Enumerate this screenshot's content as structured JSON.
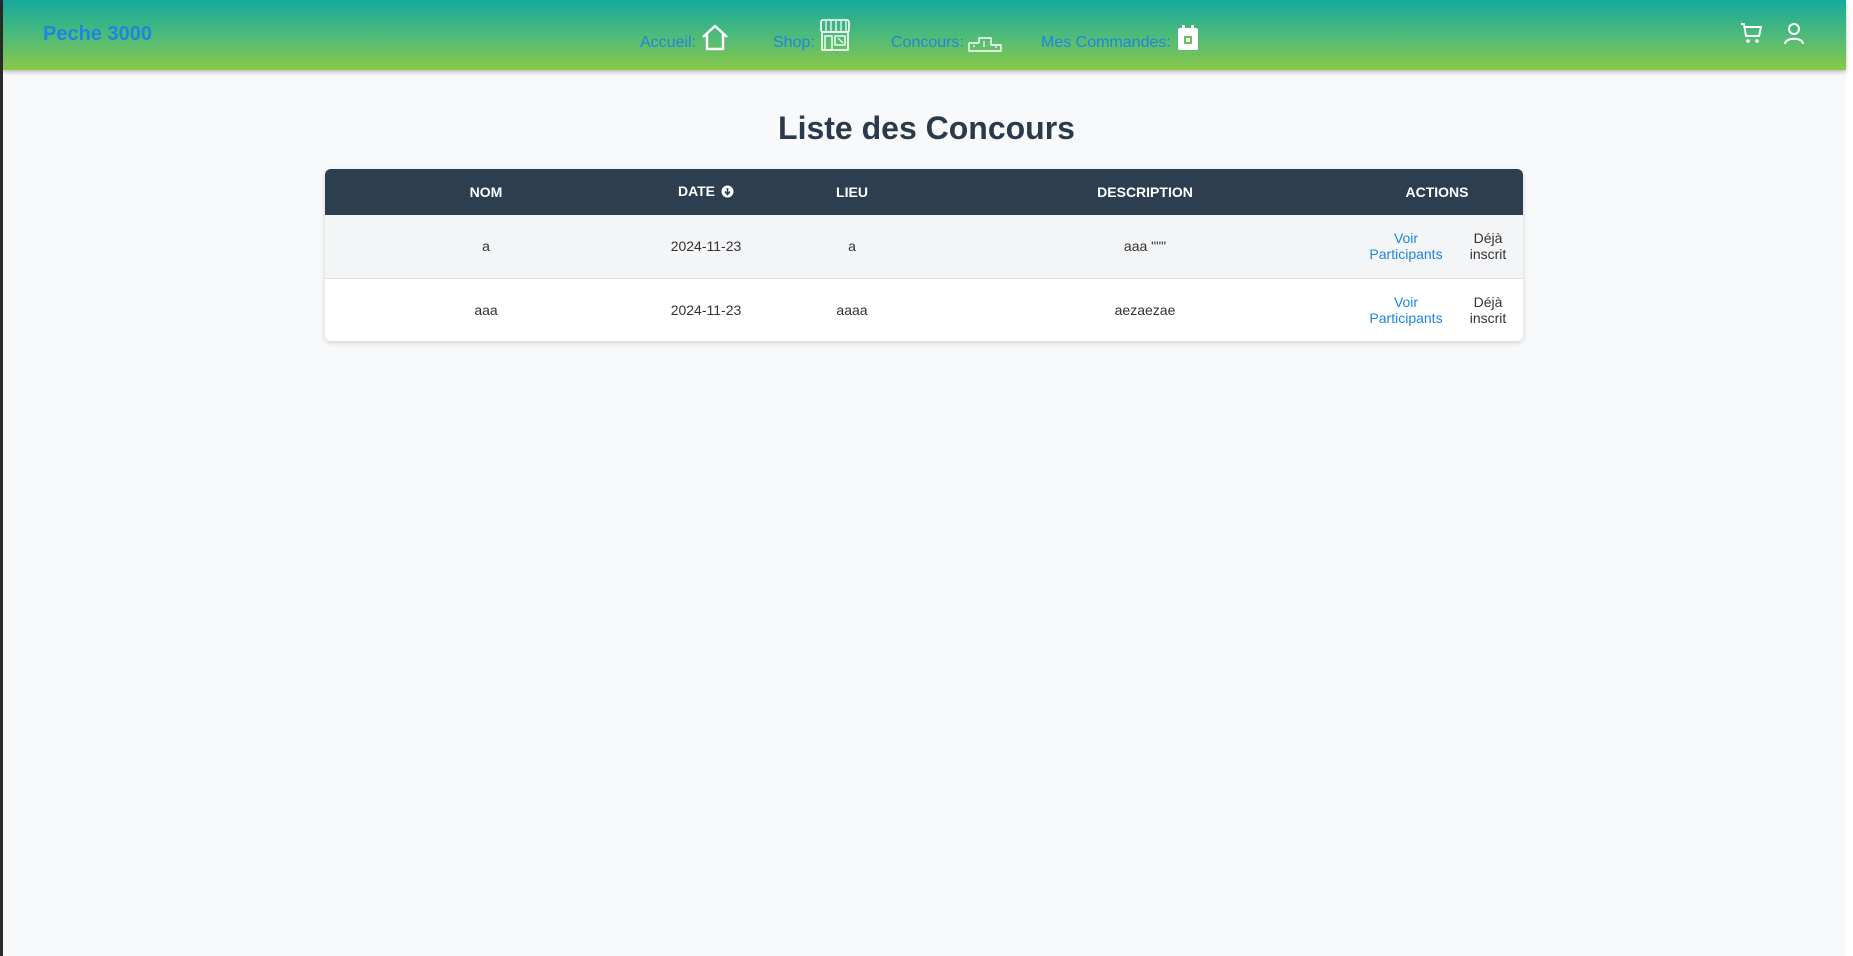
{
  "header": {
    "brand": "Peche 3000",
    "nav": [
      {
        "label": "Accueil:",
        "icon": "home-icon"
      },
      {
        "label": "Shop:",
        "icon": "shop-icon"
      },
      {
        "label": "Concours:",
        "icon": "podium-icon"
      },
      {
        "label": "Mes Commandes:",
        "icon": "calendar-icon"
      }
    ],
    "right_icons": [
      "cart-icon",
      "user-icon"
    ]
  },
  "page": {
    "title": "Liste des Concours"
  },
  "table": {
    "columns": [
      "NOM",
      "DATE",
      "LIEU",
      "DESCRIPTION",
      "ACTIONS"
    ],
    "sort_icon": "sort-desc-icon",
    "rows": [
      {
        "nom": "a",
        "date": "2024-11-23",
        "lieu": "a",
        "description": "aaa \"\"\"",
        "voir": "Voir Participants",
        "statut": "Déjà inscrit"
      },
      {
        "nom": "aaa",
        "date": "2024-11-23",
        "lieu": "aaaa",
        "description": "aezaezae",
        "voir": "Voir Participants",
        "statut": "Déjà inscrit"
      }
    ]
  },
  "colors": {
    "brand": "#1d86e0",
    "header_top": "#14a99c",
    "header_bottom": "#8ac848",
    "table_header": "#2c3e50"
  }
}
